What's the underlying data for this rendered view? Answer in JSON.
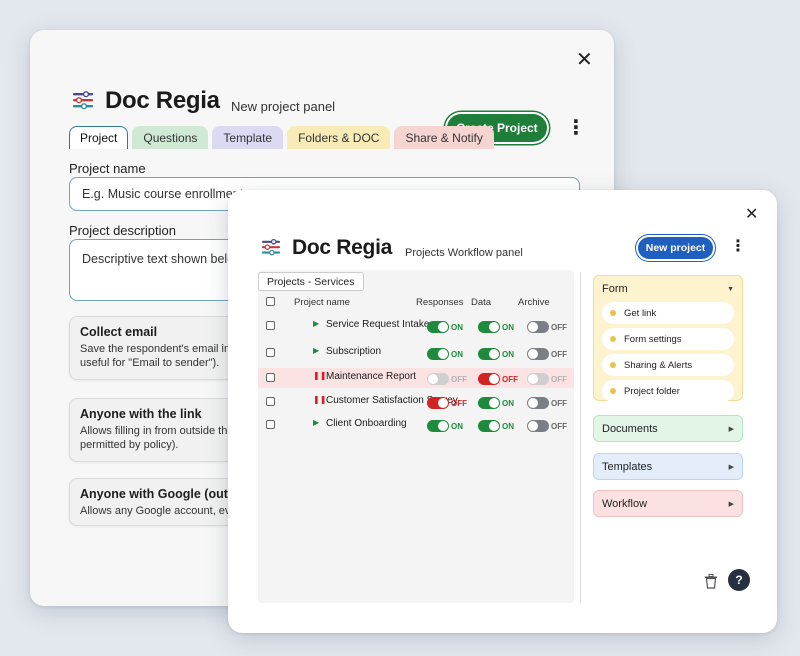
{
  "back_panel": {
    "app_title": "Doc Regia",
    "subtitle": "New project panel",
    "tabs": [
      {
        "label": "Project",
        "color": "#ffffff"
      },
      {
        "label": "Questions",
        "color": "#cfe9d5"
      },
      {
        "label": "Template",
        "color": "#dcd9f2"
      },
      {
        "label": "Folders & DOC",
        "color": "#f8ebb6"
      },
      {
        "label": "Share & Notify",
        "color": "#f6d4d1"
      }
    ],
    "create_button": "Create Project",
    "project_name_label": "Project name",
    "project_name_placeholder": "E.g. Music course enrollment",
    "project_desc_label": "Project description",
    "project_desc_placeholder": "Descriptive text shown below",
    "options": [
      {
        "title": "Collect email",
        "desc1": "Save the respondent's email in r",
        "desc2": "useful for \"Email to sender\")."
      },
      {
        "title": "Anyone with the link",
        "desc1": "Allows filling in from outside the",
        "desc2": "permitted by policy)."
      },
      {
        "title": "Anyone with Google (outsic",
        "desc1": "Allows any Google account, eve",
        "desc2": ""
      }
    ]
  },
  "front_panel": {
    "app_title": "Doc Regia",
    "subtitle": "Projects Workflow panel",
    "new_project_button": "New project",
    "breadcrumb": "Projects - Services",
    "columns": {
      "name": "Project name",
      "responses": "Responses",
      "data": "Data",
      "archive": "Archive"
    },
    "rows": [
      {
        "name": "Service Request Intake",
        "status": "play",
        "responses": "ON",
        "data": "ON",
        "archive": "OFF",
        "highlight": false
      },
      {
        "name": "Subscription",
        "status": "play",
        "responses": "ON",
        "data": "ON",
        "archive": "OFF",
        "highlight": false
      },
      {
        "name": "Maintenance Report",
        "status": "pause",
        "responses": "OFF",
        "data": "OFF",
        "archive": "OFF",
        "highlight": true
      },
      {
        "name": "Customer Satisfaction Survey",
        "status": "pause",
        "responses": "OFF",
        "data": "ON",
        "archive": "OFF",
        "highlight": false
      },
      {
        "name": "Client Onboarding",
        "status": "play",
        "responses": "ON",
        "data": "ON",
        "archive": "OFF",
        "highlight": false
      }
    ],
    "side": {
      "form": {
        "label": "Form",
        "items": [
          "Get link",
          "Form settings",
          "Sharing & Alerts",
          "Project folder"
        ]
      },
      "documents": "Documents",
      "templates": "Templates",
      "workflow": "Workflow"
    }
  },
  "colors": {
    "accent_green": "#1f7f3a",
    "accent_blue": "#1f5fbf",
    "toggle_on": "#1e8a3c",
    "toggle_red": "#d32424",
    "form_card": "#fdf3cf",
    "documents_card": "#e3f5e6",
    "templates_card": "#e4eefa",
    "workflow_card": "#fbe1e1"
  }
}
